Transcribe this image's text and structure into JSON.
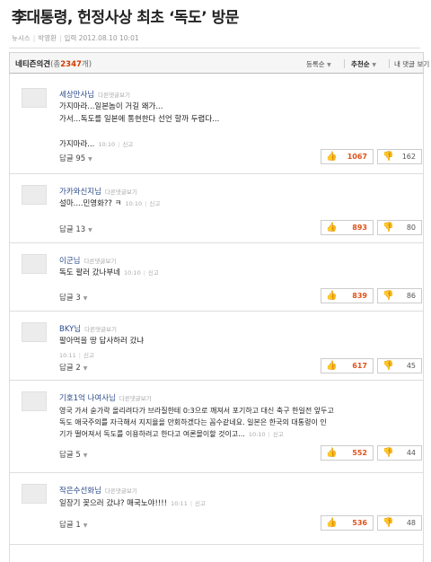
{
  "article": {
    "headline": "李대통령, 헌정사상 최초 ‘독도’ 방문",
    "source": "뉴시스",
    "reporter": "박영환",
    "date_label": "입력",
    "date": "2012.08.10 10:01"
  },
  "comments_header": {
    "title": "네티즌의견",
    "count_prefix": "(총",
    "count": "2347",
    "count_suffix": "개)",
    "sort_options": [
      "등록순",
      "추천순",
      "내 댓글 보기"
    ],
    "active_sort": "추천순"
  },
  "labels": {
    "reply_prefix": "답글",
    "more_link": "다른댓글보기",
    "report": "신고"
  },
  "comments": [
    {
      "author": "세상만사님",
      "lines": [
        "가지마라...일본놈이 거길 왜가...",
        "가서...독도를 일본에 통현한다 선언 할까 두렵다...",
        "",
        "가지마라..."
      ],
      "time": "10:10",
      "replies": "95",
      "up": "1067",
      "down": "162"
    },
    {
      "author": "가카와신지님",
      "lines": [
        "설마....민영화?? ㅋ"
      ],
      "time": "10:10",
      "replies": "13",
      "up": "893",
      "down": "80"
    },
    {
      "author": "이군님",
      "lines": [
        "독도 팔러 갔나부네"
      ],
      "time": "10:10",
      "replies": "3",
      "up": "839",
      "down": "86"
    },
    {
      "author": "BKY님",
      "lines": [
        "팔아먹을 땅 답사하러 갔냐"
      ],
      "time": "10:11",
      "replies": "2",
      "up": "617",
      "down": "45"
    },
    {
      "author": "기호1억 나여사님",
      "lines": [
        "영국 가서 숟가락 올리려다가 브라질한테 0:3으로 깨져서 포기하고 대신 축구 한일전 앞두고",
        "독도 애국주의를 자극해서 지지율을 만회하겠다는 꼼수같네요. 일본은 한국의 대통령이 인",
        "기가 떨어져서 독도를 이용하려고 한다고 여론몰이할 것이고..."
      ],
      "time": "10:10",
      "replies": "5",
      "up": "552",
      "down": "44"
    },
    {
      "author": "작은수선화님",
      "lines": [
        "일장기 꽂으러 갔냐? 매국노야!!!!"
      ],
      "time": "10:11",
      "replies": "1",
      "up": "536",
      "down": "48"
    }
  ]
}
